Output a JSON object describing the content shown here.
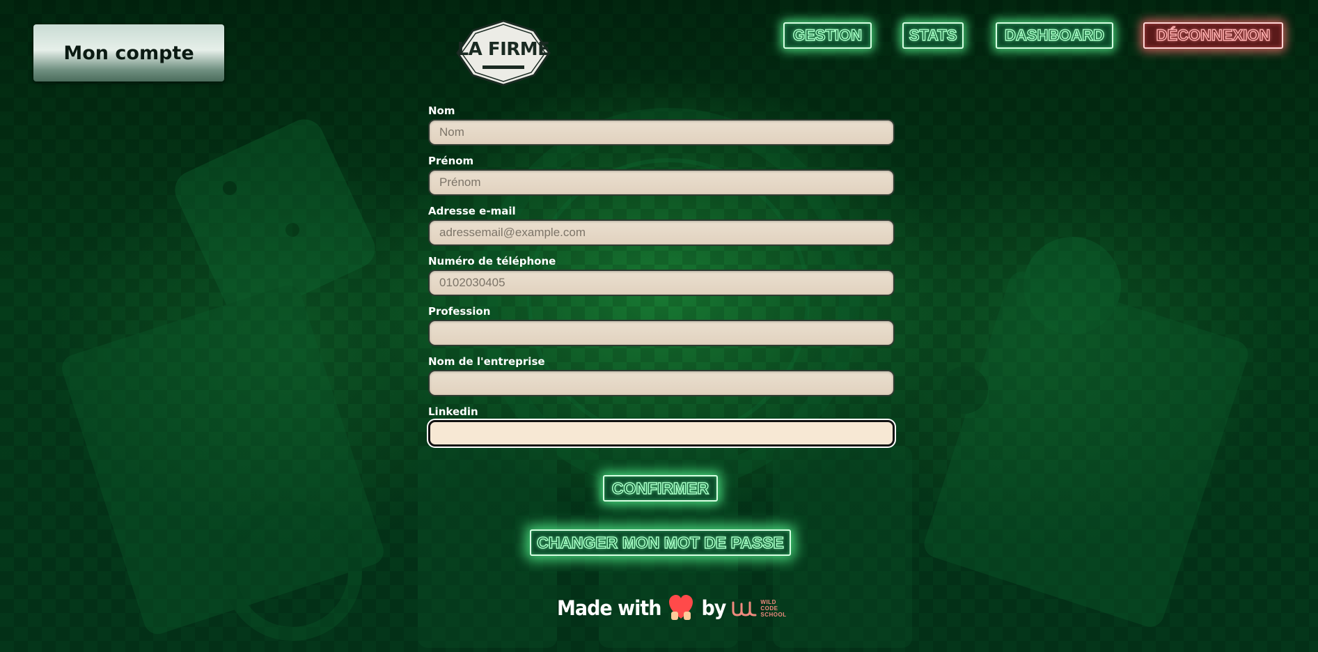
{
  "header": {
    "account_label": "Mon compte",
    "logo_text": "LA FIRME"
  },
  "nav": {
    "gestion": "GESTION",
    "stats": "STATS",
    "dashboard": "DASHBOARD",
    "logout": "DÉCONNEXION"
  },
  "form": {
    "fields": [
      {
        "label": "Nom",
        "placeholder": "Nom",
        "value": ""
      },
      {
        "label": "Prénom",
        "placeholder": "Prénom",
        "value": ""
      },
      {
        "label": "Adresse e-mail",
        "placeholder": "adressemail@example.com",
        "value": ""
      },
      {
        "label": "Numéro de téléphone",
        "placeholder": "0102030405",
        "value": ""
      },
      {
        "label": "Profession",
        "placeholder": "",
        "value": ""
      },
      {
        "label": "Nom de l'entreprise",
        "placeholder": "",
        "value": ""
      },
      {
        "label": "Linkedin",
        "placeholder": "",
        "value": ""
      }
    ],
    "confirm_label": "CONFIRMER",
    "change_password_label": "CHANGER MON MOT DE PASSE"
  },
  "footer": {
    "made_with": "Made with",
    "by": "by",
    "school_line1": "WILD",
    "school_line2": "CODE",
    "school_line3": "SCHOOL"
  },
  "colors": {
    "neon_green": "#a8ffc6",
    "neon_red": "#ffb0b0",
    "background": "#053c1a",
    "input_bg": "#e6d8c6"
  }
}
